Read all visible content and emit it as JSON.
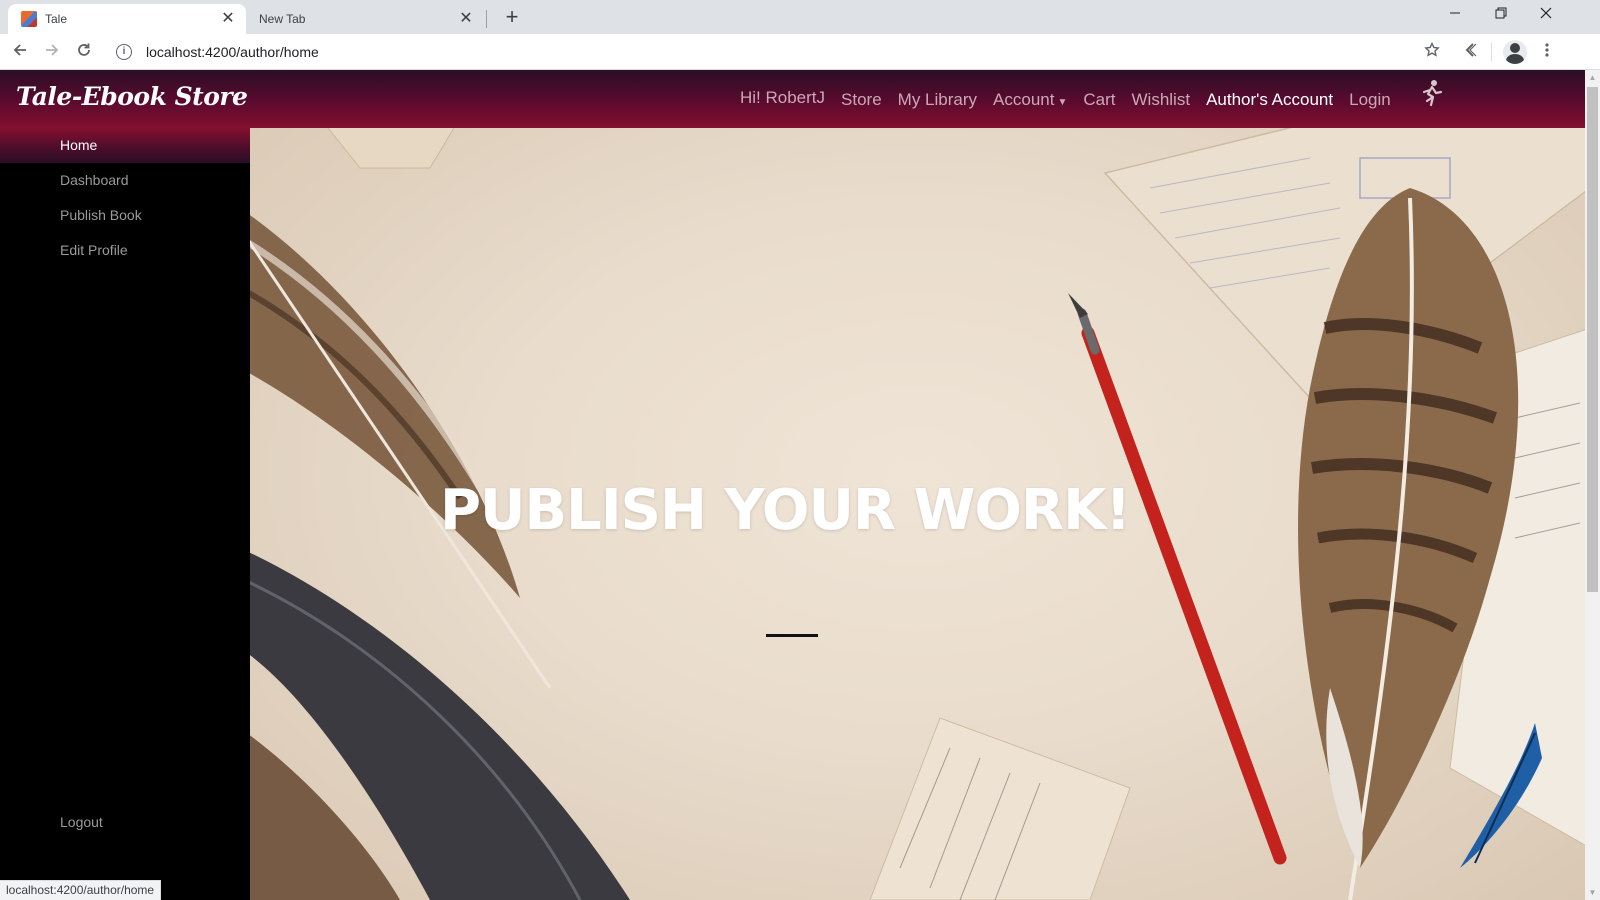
{
  "browser": {
    "tabs": [
      {
        "title": "Tale",
        "active": true
      },
      {
        "title": "New Tab",
        "active": false
      }
    ],
    "tab_close_glyph": "✕",
    "new_tab_glyph": "+",
    "url": "localhost:4200/author/home",
    "status_url": "localhost:4200/author/home"
  },
  "navbar": {
    "brand": "Tale-Ebook Store",
    "greeting": "Hi! RobertJ",
    "links": {
      "store": "Store",
      "library": "My Library",
      "account": "Account",
      "cart": "Cart",
      "wishlist": "Wishlist",
      "authors_account": "Author's Account",
      "login": "Login"
    }
  },
  "sidebar": {
    "items": [
      {
        "label": "Home",
        "active": true
      },
      {
        "label": "Dashboard",
        "active": false
      },
      {
        "label": "Publish Book",
        "active": false
      },
      {
        "label": "Edit Profile",
        "active": false
      }
    ],
    "logout": "Logout"
  },
  "hero": {
    "title": "PUBLISH YOUR WORK!"
  },
  "colors": {
    "navbar_top": "#2a0e25",
    "navbar_bottom": "#84102e",
    "sidebar_bg": "#000000",
    "accent": "#84102e"
  },
  "icons": {
    "back": "arrow-left-icon",
    "forward": "arrow-right-icon",
    "reload": "reload-icon",
    "info": "info-icon",
    "bookmark": "star-icon",
    "extension": "extension-icon",
    "profile": "profile-icon",
    "menu": "kebab-menu-icon",
    "login": "runner-icon"
  }
}
